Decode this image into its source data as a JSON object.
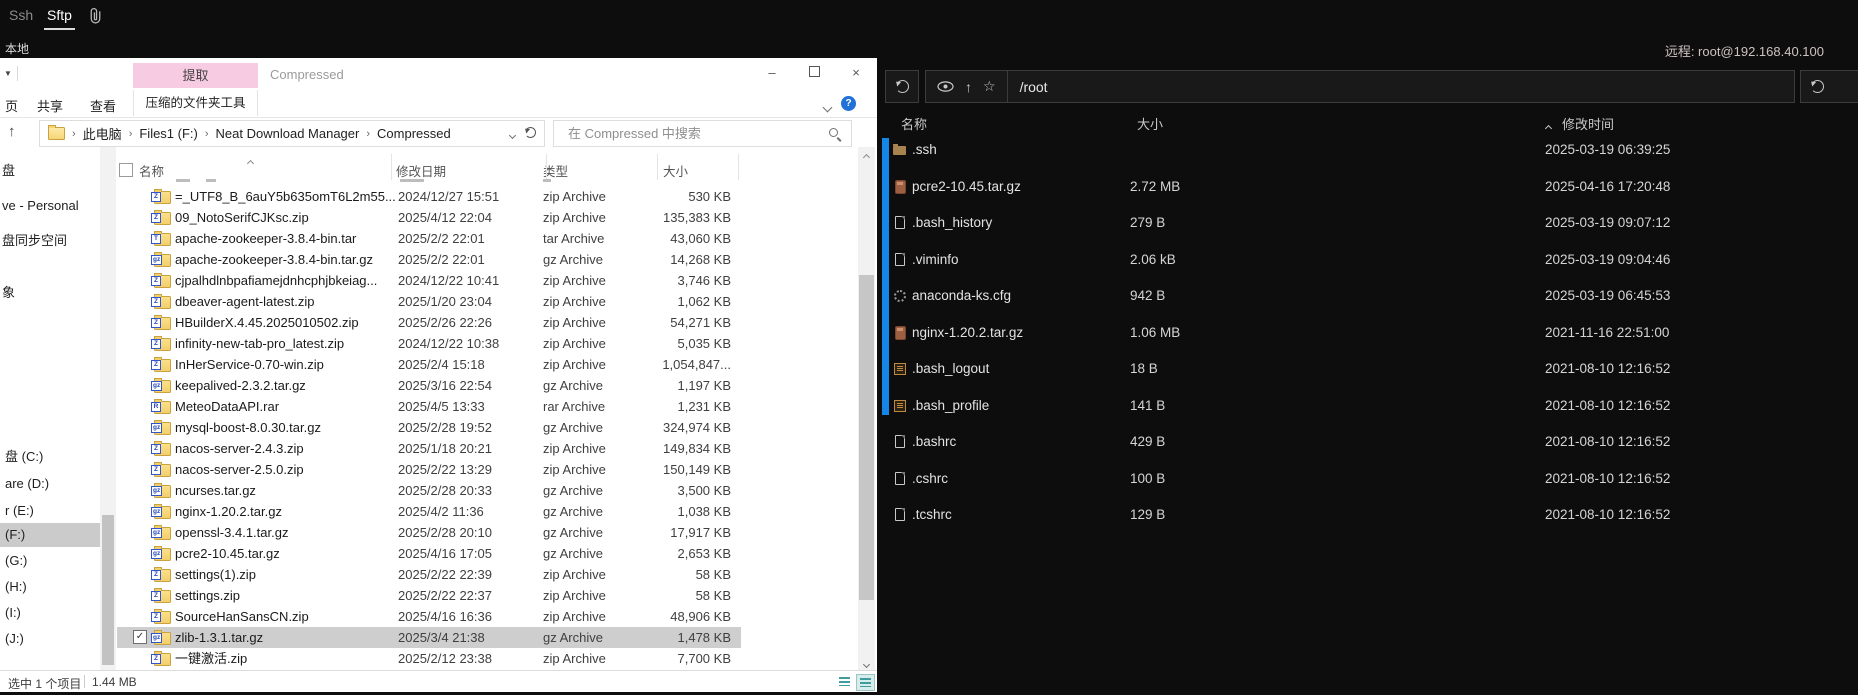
{
  "colors": {
    "extract_tab_pink": "#f7cbe2",
    "selected_row_gray": "#cecece",
    "remote_accent_blue": "#1486e8",
    "help_button_blue": "#2071d8"
  },
  "app": {
    "tabs": [
      {
        "label": "Ssh",
        "active": false
      },
      {
        "label": "Sftp",
        "active": true
      }
    ],
    "attachment_icon": "paperclip-icon",
    "local_panel_label": "本地",
    "remote_host_label": "远程: root@192.168.40.100"
  },
  "explorer": {
    "window_title": "Compressed",
    "extract_tab_label": "提取",
    "ribbon_tabs": [
      {
        "label": "页"
      },
      {
        "label": "共享"
      },
      {
        "label": "查看"
      }
    ],
    "tool_tab_label": "压缩的文件夹工具",
    "breadcrumb": [
      "此电脑",
      "Files1 (F:)",
      "Neat Download Manager",
      "Compressed"
    ],
    "search_placeholder": "在 Compressed 中搜索",
    "sidebar": {
      "items": [
        {
          "label": "盘"
        },
        {
          "label": "ve - Personal"
        },
        {
          "label": "盘同步空间"
        },
        {
          "label": "象"
        }
      ],
      "drives": [
        {
          "label": "盘 (C:)"
        },
        {
          "label": "are (D:)"
        },
        {
          "label": "r (E:)"
        },
        {
          "label": "(F:)",
          "selected": true
        },
        {
          "label": "(G:)"
        },
        {
          "label": "(H:)"
        },
        {
          "label": "(I:)"
        },
        {
          "label": "(J:)"
        }
      ]
    },
    "columns": {
      "name": "名称",
      "date": "修改日期",
      "type": "类型",
      "size": "大小"
    },
    "files": [
      {
        "name": "=_UTF8_B_6auY5b635omT6L2m55...",
        "date": "2024/12/27 15:51",
        "type": "zip Archive",
        "size": "530 KB",
        "icon": "zip"
      },
      {
        "name": "09_NotoSerifCJKsc.zip",
        "date": "2025/4/12 22:04",
        "type": "zip Archive",
        "size": "135,383 KB",
        "icon": "zip"
      },
      {
        "name": "apache-zookeeper-3.8.4-bin.tar",
        "date": "2025/2/2 22:01",
        "type": "tar Archive",
        "size": "43,060 KB",
        "icon": "tar"
      },
      {
        "name": "apache-zookeeper-3.8.4-bin.tar.gz",
        "date": "2025/2/2 22:01",
        "type": "gz Archive",
        "size": "14,268 KB",
        "icon": "gz"
      },
      {
        "name": "cjpalhdlnbpafiamejdnhcphjbkeiag...",
        "date": "2024/12/22 10:41",
        "type": "zip Archive",
        "size": "3,746 KB",
        "icon": "zip"
      },
      {
        "name": "dbeaver-agent-latest.zip",
        "date": "2025/1/20 23:04",
        "type": "zip Archive",
        "size": "1,062 KB",
        "icon": "zip"
      },
      {
        "name": "HBuilderX.4.45.2025010502.zip",
        "date": "2025/2/26 22:26",
        "type": "zip Archive",
        "size": "54,271 KB",
        "icon": "zip"
      },
      {
        "name": "infinity-new-tab-pro_latest.zip",
        "date": "2024/12/22 10:38",
        "type": "zip Archive",
        "size": "5,035 KB",
        "icon": "zip"
      },
      {
        "name": "InHerService-0.70-win.zip",
        "date": "2025/2/4 15:18",
        "type": "zip Archive",
        "size": "1,054,847...",
        "icon": "zip"
      },
      {
        "name": "keepalived-2.3.2.tar.gz",
        "date": "2025/3/16 22:54",
        "type": "gz Archive",
        "size": "1,197 KB",
        "icon": "gz"
      },
      {
        "name": "MeteoDataAPI.rar",
        "date": "2025/4/5 13:33",
        "type": "rar Archive",
        "size": "1,231 KB",
        "icon": "rar"
      },
      {
        "name": "mysql-boost-8.0.30.tar.gz",
        "date": "2025/2/28 19:52",
        "type": "gz Archive",
        "size": "324,974 KB",
        "icon": "gz"
      },
      {
        "name": "nacos-server-2.4.3.zip",
        "date": "2025/1/18 20:21",
        "type": "zip Archive",
        "size": "149,834 KB",
        "icon": "zip"
      },
      {
        "name": "nacos-server-2.5.0.zip",
        "date": "2025/2/22 13:29",
        "type": "zip Archive",
        "size": "150,149 KB",
        "icon": "zip"
      },
      {
        "name": "ncurses.tar.gz",
        "date": "2025/2/28 20:33",
        "type": "gz Archive",
        "size": "3,500 KB",
        "icon": "gz"
      },
      {
        "name": "nginx-1.20.2.tar.gz",
        "date": "2025/4/2 11:36",
        "type": "gz Archive",
        "size": "1,038 KB",
        "icon": "gz"
      },
      {
        "name": "openssl-3.4.1.tar.gz",
        "date": "2025/2/28 20:10",
        "type": "gz Archive",
        "size": "17,917 KB",
        "icon": "gz"
      },
      {
        "name": "pcre2-10.45.tar.gz",
        "date": "2025/4/16 17:05",
        "type": "gz Archive",
        "size": "2,653 KB",
        "icon": "gz"
      },
      {
        "name": "settings(1).zip",
        "date": "2025/2/22 22:39",
        "type": "zip Archive",
        "size": "58 KB",
        "icon": "zip"
      },
      {
        "name": "settings.zip",
        "date": "2025/2/22 22:37",
        "type": "zip Archive",
        "size": "58 KB",
        "icon": "zip"
      },
      {
        "name": "SourceHanSansCN.zip",
        "date": "2025/4/16 16:36",
        "type": "zip Archive",
        "size": "48,906 KB",
        "icon": "zip"
      },
      {
        "name": "zlib-1.3.1.tar.gz",
        "date": "2025/3/4 21:38",
        "type": "gz Archive",
        "size": "1,478 KB",
        "icon": "gz",
        "selected": true
      },
      {
        "name": "一键激活.zip",
        "date": "2025/2/12 23:38",
        "type": "zip Archive",
        "size": "7,700 KB",
        "icon": "zip"
      }
    ],
    "status": {
      "selection": "选中 1 个项目",
      "size": "1.44 MB"
    }
  },
  "remote": {
    "path": "/root",
    "columns": {
      "name": "名称",
      "size": "大小",
      "mtime": "修改时间"
    },
    "files": [
      {
        "name": ".ssh",
        "icon": "folder",
        "size": "",
        "mtime": "2025-03-19 06:39:25"
      },
      {
        "name": "pcre2-10.45.tar.gz",
        "icon": "archive",
        "size": "2.72 MB",
        "mtime": "2025-04-16 17:20:48"
      },
      {
        "name": ".bash_history",
        "icon": "file",
        "size": "279 B",
        "mtime": "2025-03-19 09:07:12"
      },
      {
        "name": ".viminfo",
        "icon": "file",
        "size": "2.06 kB",
        "mtime": "2025-03-19 09:04:46"
      },
      {
        "name": "anaconda-ks.cfg",
        "icon": "gear",
        "size": "942 B",
        "mtime": "2025-03-19 06:45:53"
      },
      {
        "name": "nginx-1.20.2.tar.gz",
        "icon": "archive",
        "size": "1.06 MB",
        "mtime": "2021-11-16 22:51:00"
      },
      {
        "name": ".bash_logout",
        "icon": "script",
        "size": "18 B",
        "mtime": "2021-08-10 12:16:52"
      },
      {
        "name": ".bash_profile",
        "icon": "script",
        "size": "141 B",
        "mtime": "2021-08-10 12:16:52"
      },
      {
        "name": ".bashrc",
        "icon": "file",
        "size": "429 B",
        "mtime": "2021-08-10 12:16:52"
      },
      {
        "name": ".cshrc",
        "icon": "file",
        "size": "100 B",
        "mtime": "2021-08-10 12:16:52"
      },
      {
        "name": ".tcshrc",
        "icon": "file",
        "size": "129 B",
        "mtime": "2021-08-10 12:16:52"
      }
    ]
  }
}
